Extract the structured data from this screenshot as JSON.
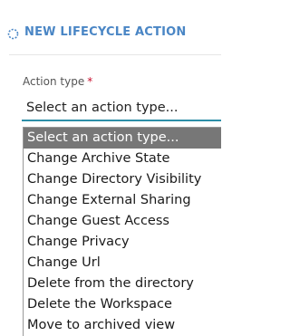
{
  "panel": {
    "title": "NEW LIFECYCLE ACTION",
    "icon": "spinner-icon"
  },
  "form": {
    "action_type_label": "Action type",
    "required_marker": "*",
    "select_value": "Select an action type..."
  },
  "dropdown": {
    "selected_index": 0,
    "options": [
      "Select an action type...",
      "Change Archive State",
      "Change Directory Visibility",
      "Change External Sharing",
      "Change Guest Access",
      "Change Privacy",
      "Change Url",
      "Delete from the directory",
      "Delete the Workspace",
      "Move to archived view"
    ]
  },
  "colors": {
    "title": "#4a86c5",
    "focus_underline": "#2d8fa8",
    "selected_option_bg": "#777777",
    "required": "#c8102e"
  }
}
